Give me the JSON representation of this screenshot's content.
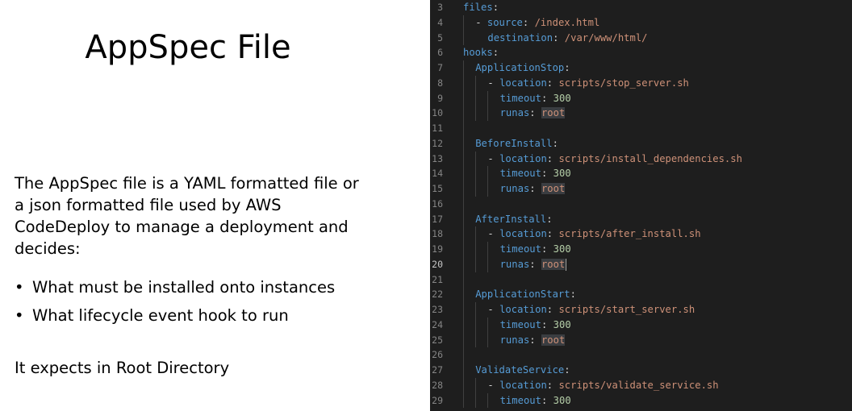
{
  "slide": {
    "title": "AppSpec File",
    "description": "The AppSpec file is a YAML formatted file or a json formatted file used by AWS CodeDeploy to manage a deployment and decides:",
    "bullets": [
      "What must be installed onto instances",
      "What lifecycle event hook to run"
    ],
    "footer": "It expects in Root Directory"
  },
  "editor": {
    "active_line": 20,
    "lines": [
      {
        "num": 3,
        "indent": 0,
        "guides": 0,
        "tokens": [
          {
            "t": "files",
            "c": "k"
          },
          {
            "t": ":",
            "c": "p"
          }
        ]
      },
      {
        "num": 4,
        "indent": 1,
        "guides": 1,
        "tokens": [
          {
            "t": "- ",
            "c": "p"
          },
          {
            "t": "source",
            "c": "k"
          },
          {
            "t": ": ",
            "c": "p"
          },
          {
            "t": "/index.html",
            "c": "s"
          }
        ]
      },
      {
        "num": 5,
        "indent": 2,
        "guides": 1,
        "tokens": [
          {
            "t": "destination",
            "c": "k"
          },
          {
            "t": ": ",
            "c": "p"
          },
          {
            "t": "/var/www/html/",
            "c": "s"
          }
        ]
      },
      {
        "num": 6,
        "indent": 0,
        "guides": 0,
        "tokens": [
          {
            "t": "hooks",
            "c": "k"
          },
          {
            "t": ":",
            "c": "p"
          }
        ]
      },
      {
        "num": 7,
        "indent": 1,
        "guides": 1,
        "tokens": [
          {
            "t": "ApplicationStop",
            "c": "k"
          },
          {
            "t": ":",
            "c": "p"
          }
        ]
      },
      {
        "num": 8,
        "indent": 2,
        "guides": 2,
        "tokens": [
          {
            "t": "- ",
            "c": "p"
          },
          {
            "t": "location",
            "c": "k"
          },
          {
            "t": ": ",
            "c": "p"
          },
          {
            "t": "scripts/stop_server.sh",
            "c": "s"
          }
        ]
      },
      {
        "num": 9,
        "indent": 3,
        "guides": 3,
        "tokens": [
          {
            "t": "timeout",
            "c": "k"
          },
          {
            "t": ": ",
            "c": "p"
          },
          {
            "t": "300",
            "c": "n"
          }
        ]
      },
      {
        "num": 10,
        "indent": 3,
        "guides": 3,
        "tokens": [
          {
            "t": "runas",
            "c": "k"
          },
          {
            "t": ": ",
            "c": "p"
          },
          {
            "t": "root",
            "c": "r"
          }
        ]
      },
      {
        "num": 11,
        "indent": 0,
        "guides": 1,
        "tokens": []
      },
      {
        "num": 12,
        "indent": 1,
        "guides": 1,
        "tokens": [
          {
            "t": "BeforeInstall",
            "c": "k"
          },
          {
            "t": ":",
            "c": "p"
          }
        ]
      },
      {
        "num": 13,
        "indent": 2,
        "guides": 2,
        "tokens": [
          {
            "t": "- ",
            "c": "p"
          },
          {
            "t": "location",
            "c": "k"
          },
          {
            "t": ": ",
            "c": "p"
          },
          {
            "t": "scripts/install_dependencies.sh",
            "c": "s"
          }
        ]
      },
      {
        "num": 14,
        "indent": 3,
        "guides": 3,
        "tokens": [
          {
            "t": "timeout",
            "c": "k"
          },
          {
            "t": ": ",
            "c": "p"
          },
          {
            "t": "300",
            "c": "n"
          }
        ]
      },
      {
        "num": 15,
        "indent": 3,
        "guides": 3,
        "tokens": [
          {
            "t": "runas",
            "c": "k"
          },
          {
            "t": ": ",
            "c": "p"
          },
          {
            "t": "root",
            "c": "r"
          }
        ]
      },
      {
        "num": 16,
        "indent": 0,
        "guides": 1,
        "tokens": []
      },
      {
        "num": 17,
        "indent": 1,
        "guides": 1,
        "tokens": [
          {
            "t": "AfterInstall",
            "c": "k"
          },
          {
            "t": ":",
            "c": "p"
          }
        ]
      },
      {
        "num": 18,
        "indent": 2,
        "guides": 2,
        "tokens": [
          {
            "t": "- ",
            "c": "p"
          },
          {
            "t": "location",
            "c": "k"
          },
          {
            "t": ": ",
            "c": "p"
          },
          {
            "t": "scripts/after_install.sh",
            "c": "s"
          }
        ]
      },
      {
        "num": 19,
        "indent": 3,
        "guides": 3,
        "tokens": [
          {
            "t": "timeout",
            "c": "k"
          },
          {
            "t": ": ",
            "c": "p"
          },
          {
            "t": "300",
            "c": "n"
          }
        ]
      },
      {
        "num": 20,
        "indent": 3,
        "guides": 3,
        "tokens": [
          {
            "t": "runas",
            "c": "k"
          },
          {
            "t": ": ",
            "c": "p"
          },
          {
            "t": "root",
            "c": "r"
          }
        ],
        "cursor": true
      },
      {
        "num": 21,
        "indent": 0,
        "guides": 1,
        "tokens": []
      },
      {
        "num": 22,
        "indent": 1,
        "guides": 1,
        "tokens": [
          {
            "t": "ApplicationStart",
            "c": "k"
          },
          {
            "t": ":",
            "c": "p"
          }
        ]
      },
      {
        "num": 23,
        "indent": 2,
        "guides": 2,
        "tokens": [
          {
            "t": "- ",
            "c": "p"
          },
          {
            "t": "location",
            "c": "k"
          },
          {
            "t": ": ",
            "c": "p"
          },
          {
            "t": "scripts/start_server.sh",
            "c": "s"
          }
        ]
      },
      {
        "num": 24,
        "indent": 3,
        "guides": 3,
        "tokens": [
          {
            "t": "timeout",
            "c": "k"
          },
          {
            "t": ": ",
            "c": "p"
          },
          {
            "t": "300",
            "c": "n"
          }
        ]
      },
      {
        "num": 25,
        "indent": 3,
        "guides": 3,
        "tokens": [
          {
            "t": "runas",
            "c": "k"
          },
          {
            "t": ": ",
            "c": "p"
          },
          {
            "t": "root",
            "c": "r"
          }
        ]
      },
      {
        "num": 26,
        "indent": 0,
        "guides": 1,
        "tokens": []
      },
      {
        "num": 27,
        "indent": 1,
        "guides": 1,
        "tokens": [
          {
            "t": "ValidateService",
            "c": "k"
          },
          {
            "t": ":",
            "c": "p"
          }
        ]
      },
      {
        "num": 28,
        "indent": 2,
        "guides": 2,
        "tokens": [
          {
            "t": "- ",
            "c": "p"
          },
          {
            "t": "location",
            "c": "k"
          },
          {
            "t": ": ",
            "c": "p"
          },
          {
            "t": "scripts/validate_service.sh",
            "c": "s"
          }
        ]
      },
      {
        "num": 29,
        "indent": 3,
        "guides": 3,
        "tokens": [
          {
            "t": "timeout",
            "c": "k"
          },
          {
            "t": ": ",
            "c": "p"
          },
          {
            "t": "300",
            "c": "n"
          }
        ]
      }
    ]
  },
  "colors": {
    "editor_background": "#1e1e1e",
    "yaml_key": "#569cd6",
    "yaml_string": "#ce9178",
    "yaml_number": "#b5cea8",
    "line_number": "#858585"
  }
}
